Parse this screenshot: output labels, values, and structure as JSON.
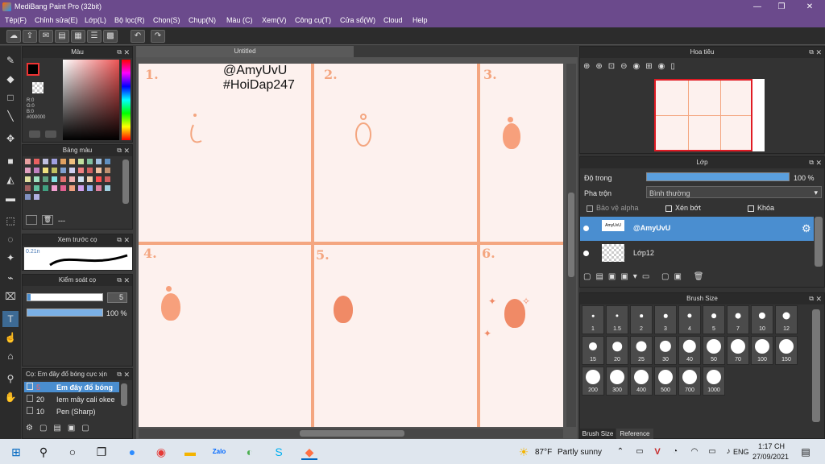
{
  "window": {
    "title": "MediBang Paint Pro (32bit)",
    "minimize": "—",
    "maximize": "❐",
    "close": "✕"
  },
  "menu": [
    "Tệp(F)",
    "Chỉnh sửa(E)",
    "Lớp(L)",
    "Bộ lọc(R)",
    "Chọn(S)",
    "Chụp(N)",
    "Màu (C)",
    "Xem(V)",
    "Công cụ(T)",
    "Cửa sổ(W)",
    "Cloud",
    "Help"
  ],
  "color_panel": {
    "title": "Màu",
    "r": "R:0",
    "g": "G:0",
    "b": "B:0",
    "hex": "#000000"
  },
  "palette_panel": {
    "title": "Bảng màu",
    "swatches": [
      "#e8a0a0",
      "#e86060",
      "#c0c0e0",
      "#a0a0e0",
      "#e0a060",
      "#f0c080",
      "#c0e0a0",
      "#80c0a0",
      "#a0c0e0",
      "#6090c0",
      "#e0a0c0",
      "#c080c0",
      "#f0e080",
      "#c0c060",
      "#80a0d0",
      "#d0d0f0",
      "#f08080",
      "#d06060",
      "#f0c0a0",
      "#c09070",
      "#e0e0a0",
      "#a0e0c0",
      "#60a080",
      "#80e0e0",
      "#e07070",
      "#f0b0b0",
      "#d0e0f0",
      "#f0d0b0",
      "#ff5050",
      "#d06060",
      "#a06060",
      "#60c0a0",
      "#40a080",
      "#f0a0d0",
      "#e06090",
      "#f0a080",
      "#d0a0f0",
      "#90b0f0",
      "#e080a0",
      "#a0d0e0",
      "#8090c0",
      "#b0b0e0"
    ],
    "count": "---"
  },
  "preview_panel": {
    "title": "Xem trước cọ",
    "size": "0.21n"
  },
  "brush_control": {
    "title": "Kiểm soát cọ",
    "size": "5",
    "opacity": "100 %",
    "size_fill": 0.95,
    "opacity_fill": 1.0
  },
  "brush_list": {
    "title": "Cọ: Em đây đổ bóng cực xịn",
    "items": [
      {
        "size": "5",
        "name": "Em đây đổ bóng"
      },
      {
        "size": "20",
        "name": "Iem mây cali okee"
      },
      {
        "size": "10",
        "name": "Pen (Sharp)"
      }
    ]
  },
  "canvas": {
    "tab": "Untitled",
    "stamp_line1": "@AmyUvU",
    "stamp_line2": "#HoiDap247",
    "numbers": [
      "1.",
      "2.",
      "3.",
      "4.",
      "5.",
      "6."
    ]
  },
  "navigator": {
    "title": "Hoa tiêu"
  },
  "layer_panel": {
    "title": "Lớp",
    "opacity_label": "Độ trong",
    "opacity_value": "100 %",
    "opacity_fill": 1.0,
    "blend_label": "Pha trộn",
    "blend_value": "Bình thường",
    "alpha_label": "Bảo vệ alpha",
    "clip_label": "Xén bớt",
    "lock_label": "Khóa",
    "layers": [
      {
        "name": "@AmyUvU",
        "thumb": "AmyUvU"
      },
      {
        "name": "Lớp12",
        "thumb": ""
      }
    ]
  },
  "brush_size": {
    "title": "Brush Size",
    "sizes": [
      "1",
      "1.5",
      "2",
      "3",
      "4",
      "5",
      "7",
      "10",
      "12",
      "15",
      "20",
      "25",
      "30",
      "40",
      "50",
      "70",
      "100",
      "150",
      "200",
      "300",
      "400",
      "500",
      "700",
      "1000"
    ],
    "tabs": [
      "Brush Size",
      "Reference"
    ]
  },
  "taskbar": {
    "weather": "87°F",
    "weather_desc": "Partly sunny",
    "lang": "ENG",
    "time": "1:17 CH",
    "date": "27/09/2021"
  }
}
